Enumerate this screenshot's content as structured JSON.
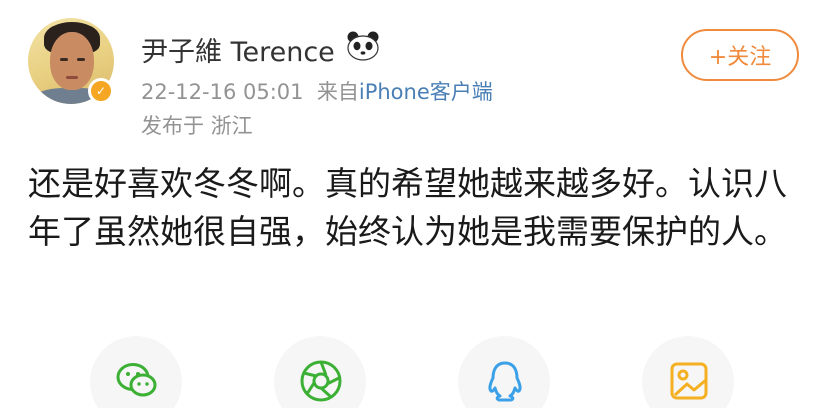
{
  "post": {
    "username": "尹子維 Terence",
    "datetime": "22-12-16 05:01",
    "source_prefix": "来自",
    "source": "iPhone客户端",
    "location": "发布于 浙江",
    "follow_label": "+关注",
    "text": "还是好喜欢冬冬啊。真的希望她越来越多好。认识八年了虽然她很自强，始终认为她是我需要保护的人。"
  },
  "share_icons": [
    "wechat-icon",
    "moments-icon",
    "qq-icon",
    "qzone-icon"
  ],
  "colors": {
    "accent": "#f08a3c",
    "meta": "#939393",
    "source": "#4a7fb5",
    "wechat": "#3cb034",
    "qq": "#3aa0e8",
    "qzone": "#f5b021"
  }
}
